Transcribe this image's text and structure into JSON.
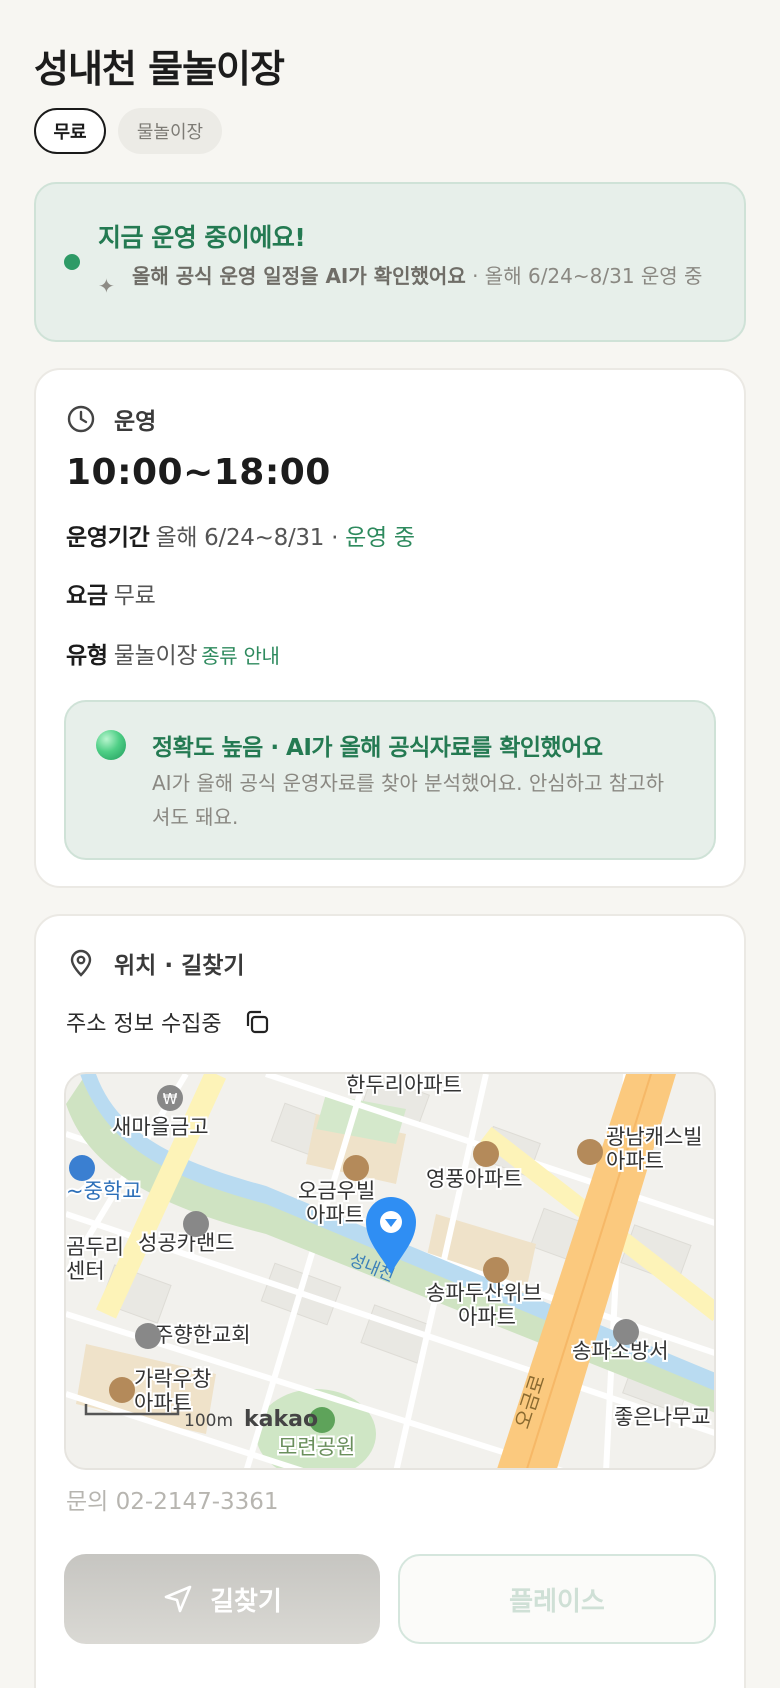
{
  "title": "성내천 물놀이장",
  "chips": {
    "fee": "무료",
    "category": "물놀이장"
  },
  "status": {
    "title": "지금 운영 중이에요!",
    "desc_strong": "올해 공식 운영 일정을 AI가 확인했어요",
    "desc_rest": " · 올해 6/24~8/31 운영 중",
    "color": "#2e9a66"
  },
  "hours_section": {
    "heading": "운영",
    "hours": "10:00~18:00",
    "period_label": "운영기간",
    "period_value": "올해 6/24~8/31 ·",
    "period_status": "운영 중",
    "fee_label": "요금",
    "fee_value": "무료",
    "type_label": "유형",
    "type_value": "물놀이장",
    "type_link": "종류 안내",
    "accuracy_title": "정확도 높음 · AI가 올해 공식자료를 확인했어요",
    "accuracy_desc": "AI가 올해 공식 운영자료를 찾아 분석했어요. 안심하고 참고하셔도 돼요."
  },
  "location_section": {
    "heading": "위치 · 길찾기",
    "address": "주소 정보 수집중",
    "phone": "문의 02-2147-3361",
    "directions_label": "길찾기",
    "place_label": "플레이스"
  },
  "map": {
    "labels": {
      "handuri": "한두리아파트",
      "saemaeul": "새마을금고",
      "gwangnam": "광남캐스빌",
      "gwangnam2": "아파트",
      "school": "~중학교",
      "ogeum": "오금우빌",
      "ogeum2": "아파트",
      "yeongpung": "영풍아파트",
      "seongnaecheon": "성내천",
      "gomduri": "곰두리",
      "gomduri2": "센터",
      "seonggong": "성공카랜드",
      "songpadusan": "송파두산위브",
      "songpadusan2": "아파트",
      "juhyang": "주향한교회",
      "garak": "가락우창",
      "garak2": "아파트",
      "firestation": "송파소방서",
      "road": "오금로",
      "scale": "100m",
      "logo": "kakao",
      "park": "모련공원",
      "joeun": "좋은나무교"
    },
    "pin_color": "#2f8ef3",
    "road_color": "#fbc97e"
  }
}
